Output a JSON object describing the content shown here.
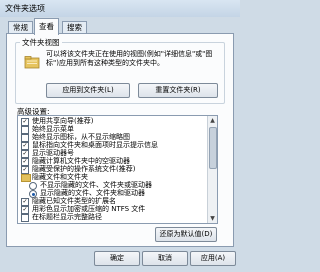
{
  "window": {
    "title": "文件夹选项"
  },
  "tabs": [
    {
      "label": "常规"
    },
    {
      "label": "查看"
    },
    {
      "label": "搜索"
    }
  ],
  "folder_views": {
    "group_label": "文件夹视图",
    "description": "可以将该文件夹正在使用的视图(例如\"详细信息\"或\"图标\")应用到所有这种类型的文件夹中。",
    "apply_button": "应用到文件夹(L)",
    "reset_button": "重置文件夹(R)"
  },
  "advanced": {
    "label": "高级设置:",
    "items": [
      {
        "text": "使用共享向导(推荐)",
        "type": "checkbox",
        "checked": true,
        "indent": 0
      },
      {
        "text": "始终显示菜单",
        "type": "checkbox",
        "checked": false,
        "indent": 0
      },
      {
        "text": "始终显示图标，从不显示缩略图",
        "type": "checkbox",
        "checked": false,
        "indent": 0
      },
      {
        "text": "鼠标指向文件夹和桌面项时显示提示信息",
        "type": "checkbox",
        "checked": true,
        "indent": 0
      },
      {
        "text": "显示驱动器号",
        "type": "checkbox",
        "checked": true,
        "indent": 0
      },
      {
        "text": "隐藏计算机文件夹中的空驱动器",
        "type": "checkbox",
        "checked": true,
        "indent": 0
      },
      {
        "text": "隐藏受保护的操作系统文件(推荐)",
        "type": "checkbox",
        "checked": true,
        "indent": 0
      },
      {
        "text": "隐藏文件和文件夹",
        "type": "folder",
        "indent": 0
      },
      {
        "text": "不显示隐藏的文件、文件夹或驱动器",
        "type": "radio",
        "checked": false,
        "indent": 1
      },
      {
        "text": "显示隐藏的文件、文件夹和驱动器",
        "type": "radio",
        "checked": true,
        "indent": 1
      },
      {
        "text": "隐藏已知文件类型的扩展名",
        "type": "checkbox",
        "checked": true,
        "indent": 0
      },
      {
        "text": "用彩色显示加密或压缩的 NTFS 文件",
        "type": "checkbox",
        "checked": true,
        "indent": 0
      },
      {
        "text": "在标题栏显示完整路径",
        "type": "checkbox",
        "checked": false,
        "indent": 0
      }
    ],
    "restore_button": "还原为默认值(D)"
  },
  "footer": {
    "ok": "确定",
    "cancel": "取消",
    "apply": "应用(A)"
  }
}
